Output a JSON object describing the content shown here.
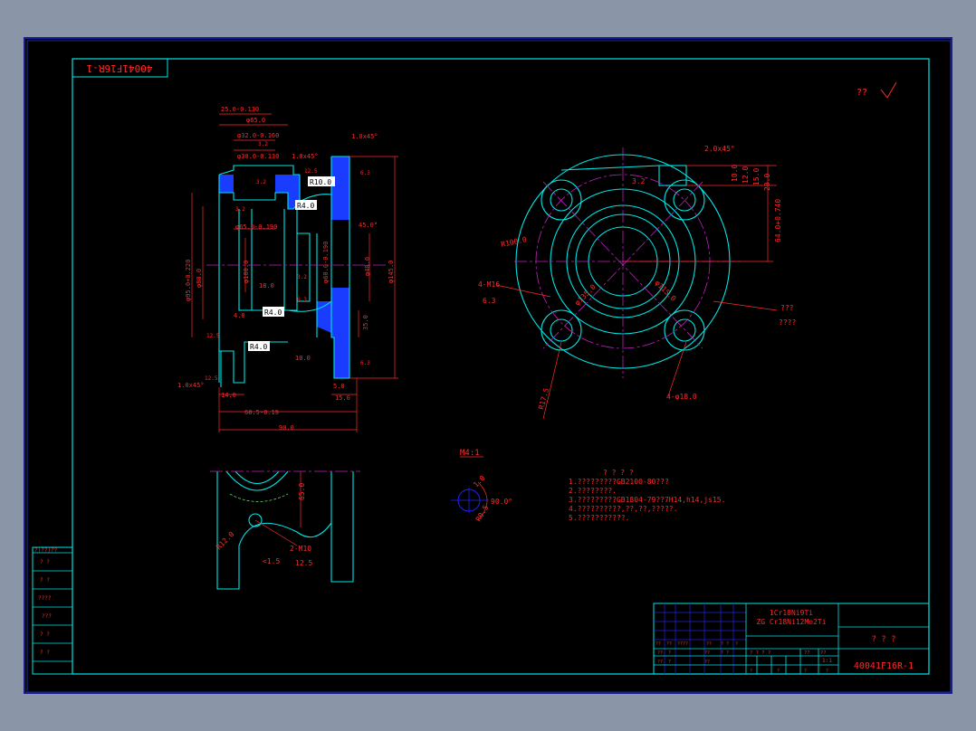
{
  "drawing": {
    "number": "40041F16R-1",
    "rotated_number": "40041F16R-1",
    "roughness_mark": "?? ",
    "colors": {
      "frame": "#00e5e5",
      "dims": "#ff2a2a",
      "hatch": "#1a3cff",
      "center": "#c020c0",
      "blue": "#2020d0",
      "title_text": "#ff2a2a"
    }
  },
  "dimensions": {
    "d1": "25.0-0.130",
    "d2": "φ65.0",
    "d3": "φ32.0-0.160",
    "d4": "φ30.0-0.130",
    "d5": "1.0x45°",
    "d6": "1.0x45°",
    "d7": "R10.0",
    "d8": "R4.0",
    "d9": "φ65.0-0.190",
    "d10": "φ95.0+0.220",
    "d11": "φ80.0",
    "d12": "φ100.0",
    "d13": "18.0",
    "d14": "4.0",
    "d15": "R4.0",
    "d16": "R4.0",
    "d17": "φ60.0-0.190",
    "d18": "φ40.0",
    "d19": "φ145.0",
    "d20": "45.0°",
    "d21": "1.0x45°",
    "d22": "14.0",
    "d23": "68.5-0.19",
    "d24": "90.0",
    "d25": "10.0",
    "d26": "5.0",
    "d27": "15.0",
    "d28": "35.0",
    "d29": "2.0x45°",
    "d30": "10.0",
    "d31": "12.0",
    "d32": "15.0",
    "d33": "20.0",
    "d34": "64.0+0.740",
    "d35": "R100.0",
    "d36": "4-M16",
    "d37": "φ135.0",
    "d38": "φ115.0",
    "d39": "R17.5",
    "d40": "4-φ18.0",
    "d41": "???",
    "d42": "????",
    "d43": "65.0",
    "d44": "R12.0",
    "d45": "2-M10",
    "d46": "<1.5",
    "d47": "90.0°",
    "d48": "M4:1",
    "d49": "1.0",
    "d50": "R0.5"
  },
  "roughness": {
    "r1": "3.2",
    "r2": "12.5",
    "r3": "3.2",
    "r4": "6.3",
    "r5": "3.2",
    "r6": "12.5",
    "r7": "3.2",
    "r8": "6.3",
    "r9": "6.3",
    "r10": "12.5",
    "r11": "6.3",
    "r12": "3.2",
    "r13": "12.5",
    "r14": "6.3",
    "r15": "3.2",
    "r16": "12.5",
    "r17": "6.3"
  },
  "notes": {
    "heading": "? ? ? ?",
    "items": [
      "1.?????????GB2100-80???",
      "2.????????.",
      "3.?????????GB1804-79??7H14,h14,js15.",
      "4.??????????,??,??,?????.",
      "5.???????????."
    ]
  },
  "left_table": {
    "header": "?(??)??",
    "rows": [
      "?  ?",
      "?  ?",
      "????",
      "???",
      "?  ?",
      "?  ?"
    ]
  },
  "title_block": {
    "material_1": "1Cr18Ni9Ti",
    "material_2": "ZG Cr18Ni12Mo2Ti",
    "part_name": "?  ?  ?",
    "drawing_number": "40041F16R-1",
    "row_labels_1": [
      "??",
      "??",
      "????",
      "??",
      "?  ?",
      "?"
    ],
    "row_labels_2": [
      "??",
      "?",
      "??",
      "?  ?"
    ],
    "row_labels_3": [
      "??",
      "?",
      "??"
    ],
    "scale_label": "??",
    "scale_value": "1:1",
    "mass_label": "??",
    "stage_label": "?  ?  ?  ?",
    "sheet_row": [
      "?",
      "?",
      "?",
      "?"
    ]
  }
}
